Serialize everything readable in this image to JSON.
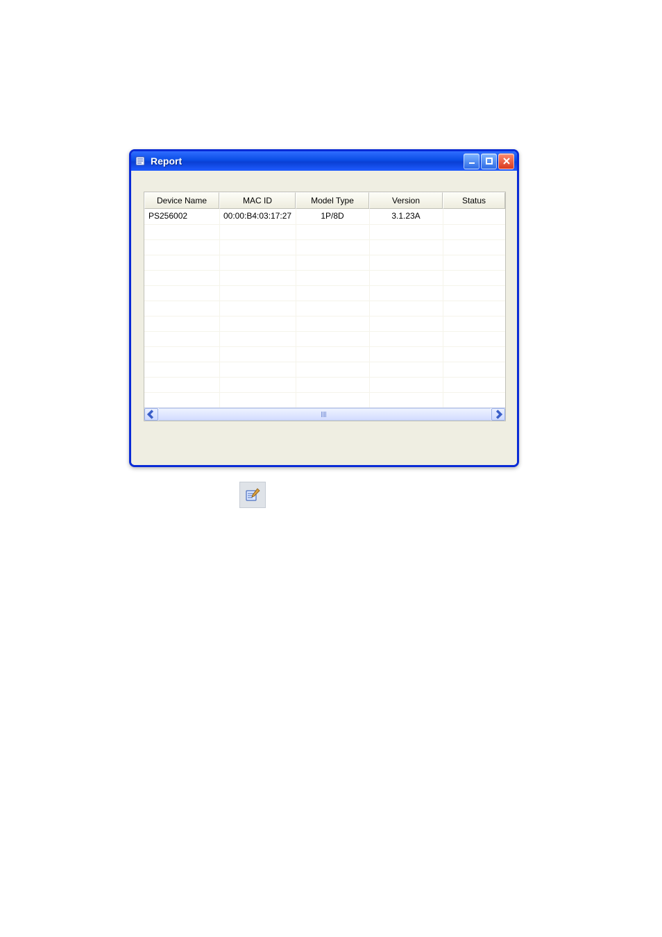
{
  "window": {
    "title": "Report"
  },
  "table": {
    "columns": [
      "Device Name",
      "MAC ID",
      "Model Type",
      "Version",
      "Status"
    ],
    "rows": [
      {
        "device_name": "PS256002",
        "mac_id": "00:00:B4:03:17:27",
        "model_type": "1P/8D",
        "version": "3.1.23A",
        "status": ""
      }
    ]
  }
}
